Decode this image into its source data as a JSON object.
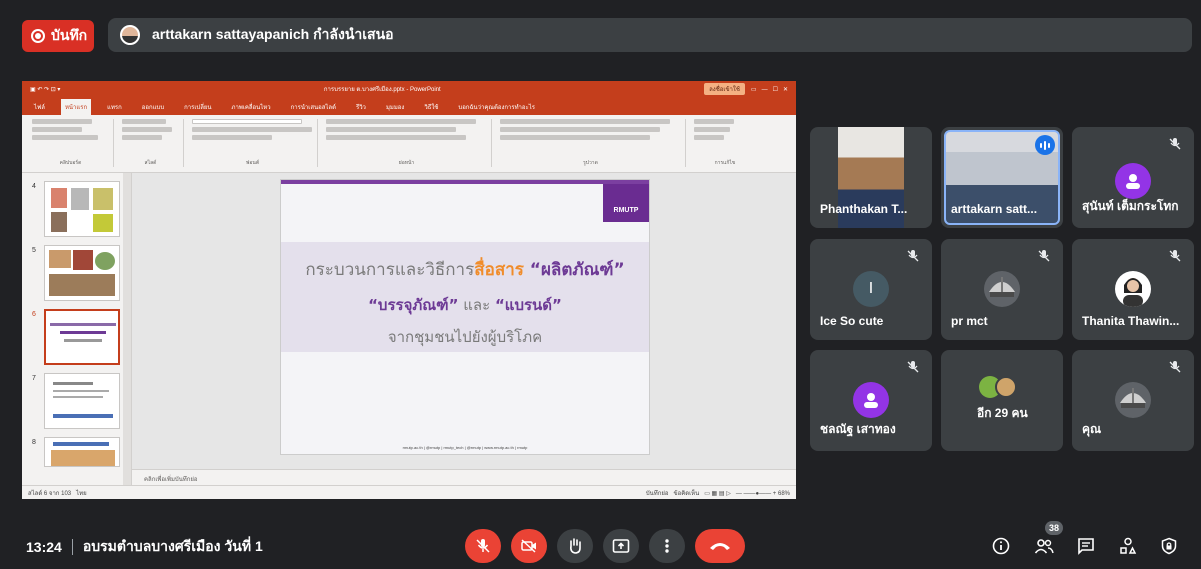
{
  "top": {
    "record_label": "บันทึก",
    "presenter_text": "arttakarn sattayapanich กำลังนำเสนอ"
  },
  "ppt": {
    "window_title": "การบรรยาย ต.บางศรีเมือง.pptx - PowerPoint",
    "share_label": "ลงชื่อเข้าใช้",
    "tabs": [
      "ไฟล์",
      "หน้าแรก",
      "แทรก",
      "ออกแบบ",
      "การเปลี่ยน",
      "ภาพเคลื่อนไหว",
      "การนำเสนอสไลด์",
      "รีวิว",
      "มุมมอง",
      "วิธีใช้",
      "บอกฉันว่าคุณต้องการทำอะไร"
    ],
    "ribbon_groups": [
      "คลิปบอร์ด",
      "สไลด์",
      "ฟอนต์",
      "ย่อหน้า",
      "รูปวาด",
      "การแก้ไข"
    ],
    "thumb_numbers": [
      "4",
      "5",
      "6",
      "7",
      "8"
    ],
    "slide": {
      "logo": "RMUTP",
      "line1_a": "กระบวนการและวิธีการ",
      "line1_b": "สื่อสาร",
      "line1_c": " “ผลิตภัณฑ์”",
      "line2_a": "“บรรจุภัณฑ์”",
      "line2_b": " และ ",
      "line2_c": "“แบรนด์”",
      "line3": "จากชุมชนไปยังผู้บริโภค",
      "footer": "rmutp.ac.th | @rmutp | rmutp_tech | @rmutp | www.rmutp.ac.th | rmutp"
    },
    "notes_placeholder": "คลิกเพื่อเพิ่มบันทึกย่อ",
    "status_left": "สไลด์ 6 จาก 103",
    "status_lang": "ไทย",
    "status_notes": "บันทึกย่อ",
    "status_comments": "ข้อคิดเห็น",
    "zoom": "68%"
  },
  "participants": [
    {
      "name": "Phanthakan T...",
      "muted": false
    },
    {
      "name": "arttakarn satt...",
      "muted": false,
      "speaking": true
    },
    {
      "name": "สุนันท์ เต็มกระโทก",
      "muted": true
    },
    {
      "name": "Ice So cute",
      "muted": true,
      "initial": "I",
      "color": "#455a64"
    },
    {
      "name": "pr mct",
      "muted": true
    },
    {
      "name": "Thanita Thawin...",
      "muted": true
    },
    {
      "name": "ชลณัฐ เสาทอง",
      "muted": true
    },
    {
      "name": "อีก 29 คน",
      "muted": false
    },
    {
      "name": "คุณ",
      "muted": true
    }
  ],
  "colors": {
    "avatar_purple": "#9334e6",
    "end_red": "#ea4335",
    "ppt_orange": "#c43e1c"
  },
  "bottom": {
    "time": "13:24",
    "meeting_title": "อบรมตำบลบางศรีเมือง วันที่ 1",
    "people_count": "38"
  }
}
